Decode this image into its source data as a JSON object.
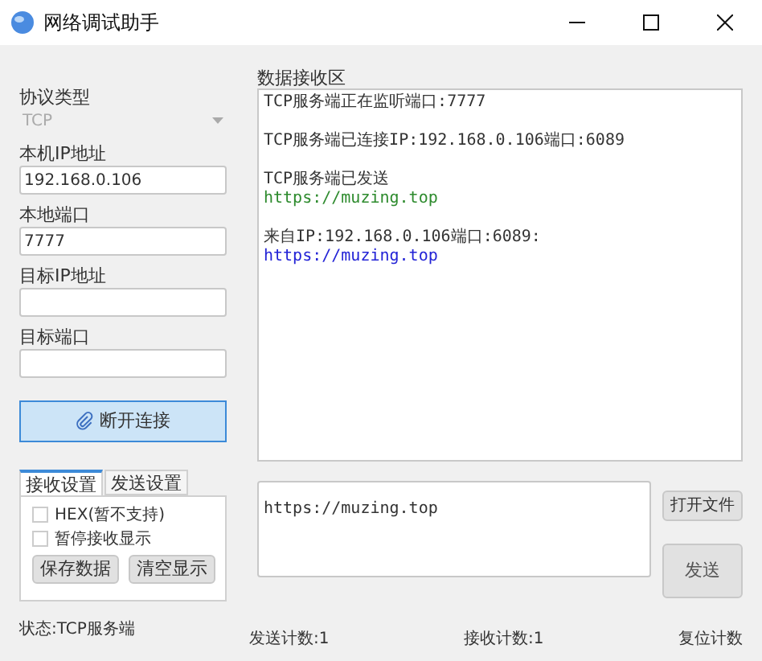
{
  "window": {
    "title": "网络调试助手"
  },
  "settings": {
    "protocol_label": "协议类型",
    "protocol": {
      "value": "TCP",
      "disabled": true
    },
    "fields": [
      {
        "label": "本机IP地址",
        "value": "192.168.0.106"
      },
      {
        "label": "本地端口",
        "value": "7777"
      },
      {
        "label": "目标IP地址"
      },
      {
        "label": "目标端口"
      }
    ],
    "connect_button": "断开连接"
  },
  "tabs": [
    {
      "label": "接收设置",
      "selected": true
    },
    {
      "label": "发送设置",
      "selected": false
    }
  ],
  "options": [
    {
      "label": "HEX(暂不支持)",
      "checked": false
    },
    {
      "label": "暂停接收显示",
      "checked": false
    }
  ],
  "option_buttons": [
    "保存数据",
    "清空显示"
  ],
  "receive": {
    "label": "数据接收区",
    "messages": [
      {
        "lines": [
          {
            "text": "TCP服务端正在监听端口:7777",
            "color": "#333333"
          }
        ]
      },
      {
        "lines": [
          {
            "text": "TCP服务端已连接IP:192.168.0.106端口:6089",
            "color": "#333333"
          }
        ]
      },
      {
        "lines": [
          {
            "text": "TCP服务端已发送",
            "color": "#333333"
          },
          {
            "text": "https://muzing.top",
            "color": "#2e8b2e"
          }
        ]
      },
      {
        "lines": [
          {
            "text": "来自IP:192.168.0.106端口:6089:",
            "color": "#333333"
          },
          {
            "text": "https://muzing.top",
            "color": "#2323d6"
          }
        ]
      }
    ]
  },
  "send": {
    "value": "https://muzing.top",
    "open_file_button": "打开文件",
    "send_button": "发送"
  },
  "status_bar": {
    "status": "状态:TCP服务端",
    "sent_count": "发送计数:1",
    "received_count": "接收计数:1",
    "reset": "复位计数"
  }
}
